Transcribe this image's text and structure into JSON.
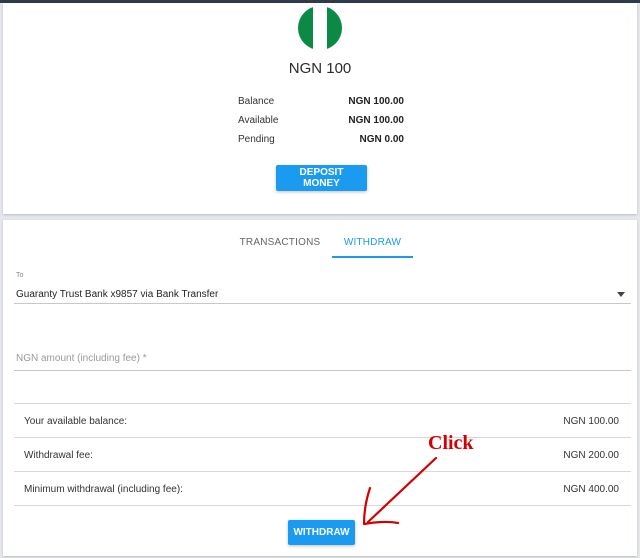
{
  "wallet": {
    "title": "NGN 100",
    "flag_colors": [
      "#0b8a45",
      "#ffffff",
      "#0b8a45"
    ],
    "rows": [
      {
        "label": "Balance",
        "value": "NGN 100.00"
      },
      {
        "label": "Available",
        "value": "NGN 100.00"
      },
      {
        "label": "Pending",
        "value": "NGN 0.00"
      }
    ],
    "deposit_label": "DEPOSIT MONEY"
  },
  "tabs": [
    {
      "label": "TRANSACTIONS",
      "active": false
    },
    {
      "label": "WITHDRAW",
      "active": true
    }
  ],
  "withdraw_form": {
    "to_caption": "To",
    "to_value": "Guaranty Trust Bank x9857 via Bank Transfer",
    "amount_placeholder": "NGN amount (including fee) *",
    "amount_value": "",
    "info": [
      {
        "label": "Your available balance:",
        "value": "NGN 100.00"
      },
      {
        "label": "Withdrawal fee:",
        "value": "NGN 200.00"
      },
      {
        "label": "Minimum withdrawal (including fee):",
        "value": "NGN 400.00"
      }
    ],
    "submit_label": "WITHDRAW"
  },
  "annotation": {
    "text": "Click",
    "color": "#d40000"
  },
  "colors": {
    "accent": "#1a9bf0",
    "page_bg": "#e4e7ec"
  }
}
